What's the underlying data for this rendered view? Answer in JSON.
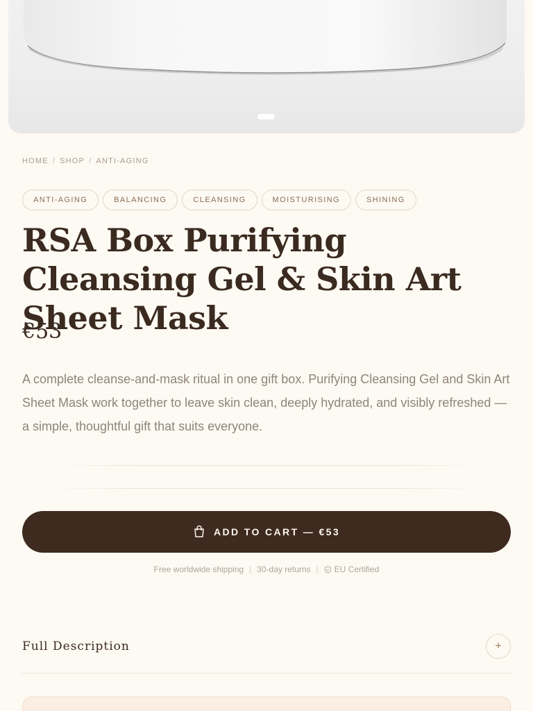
{
  "breadcrumb": {
    "home": "HOME",
    "shop": "SHOP",
    "category": "ANTI-AGING"
  },
  "tags": [
    "ANTI-AGING",
    "BALANCING",
    "CLEANSING",
    "MOISTURISING",
    "SHINING"
  ],
  "product": {
    "title": "RSA Box Purifying Cleansing Gel & Skin Art Sheet Mask",
    "price": "€53",
    "description": "A complete cleanse-and-mask ritual in one gift box. Purifying Cleansing Gel and Skin Art Sheet Mask work together to leave skin clean, deeply hydrated, and visibly refreshed — a simple, thoughtful gift that suits everyone."
  },
  "cart": {
    "label": "ADD TO CART — €53",
    "icon": "shopping-bag-icon"
  },
  "perks": {
    "shipping": "Free worldwide shipping",
    "returns": "30-day returns",
    "certified": "EU Certified"
  },
  "accordion": {
    "full_description": "Full Description",
    "toggle": "+"
  },
  "colors": {
    "background": "#fdf9f3",
    "button": "#3e2a1e",
    "tag_text": "#8a6d52",
    "muted": "#8f847b"
  }
}
